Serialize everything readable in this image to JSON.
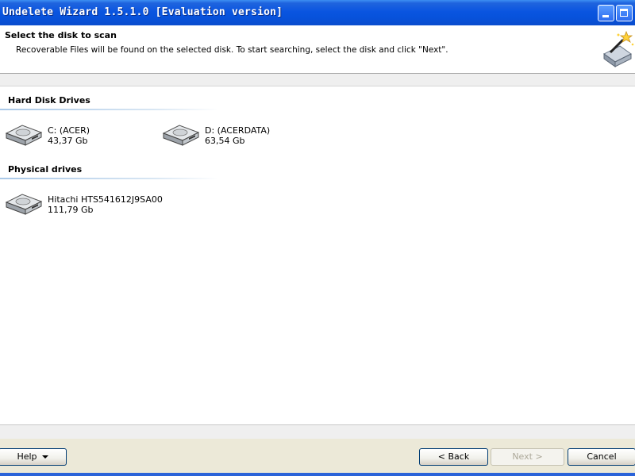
{
  "window": {
    "title": "Undelete Wizard 1.5.1.0 [Evaluation version]"
  },
  "header": {
    "title": "Select the disk to scan",
    "subtitle": "Recoverable Files will be found on the selected disk. To start searching, select the disk and click \"Next\"."
  },
  "sections": {
    "hard_disk": {
      "title": "Hard Disk Drives",
      "drives": [
        {
          "name": "C: (ACER)",
          "size": "43,37 Gb"
        },
        {
          "name": "D: (ACERDATA)",
          "size": "63,54 Gb"
        }
      ]
    },
    "physical": {
      "title": "Physical drives",
      "drives": [
        {
          "name": "Hitachi HTS541612J9SA00",
          "size": "111,79 Gb"
        }
      ]
    }
  },
  "buttons": {
    "help": "Help",
    "back": "< Back",
    "next": "Next >",
    "cancel": "Cancel"
  },
  "icons": {
    "drive": "hard-drive-icon",
    "wizard": "magic-wand-disk-icon",
    "minimize": "minimize-icon",
    "maximize": "maximize-icon"
  },
  "colors": {
    "titlebar": "#0a55e0",
    "footer": "#ece9d8",
    "section_line": "#a9c8e8"
  }
}
